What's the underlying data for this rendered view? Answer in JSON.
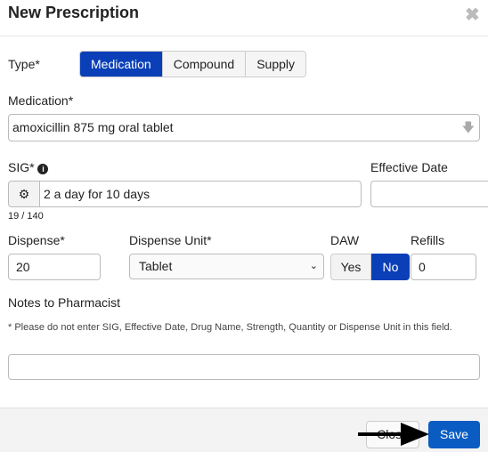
{
  "header": {
    "title": "New Prescription",
    "close_icon": "close-icon"
  },
  "type": {
    "label": "Type*",
    "options": [
      "Medication",
      "Compound",
      "Supply"
    ],
    "selected": "Medication"
  },
  "medication": {
    "label": "Medication*",
    "value": "amoxicillin 875 mg oral tablet"
  },
  "sig": {
    "label": "SIG*",
    "value": "2 a day for 10 days",
    "counter": "19 / 140"
  },
  "effective_date": {
    "label": "Effective Date",
    "value": ""
  },
  "dispense": {
    "label": "Dispense*",
    "value": "20"
  },
  "dispense_unit": {
    "label": "Dispense Unit*",
    "value": "Tablet"
  },
  "daw": {
    "label": "DAW",
    "yes": "Yes",
    "no": "No",
    "selected": "No"
  },
  "refills": {
    "label": "Refills",
    "value": "0"
  },
  "notes": {
    "label": "Notes to Pharmacist",
    "hint": "* Please do not enter SIG, Effective Date, Drug Name, Strength, Quantity or Dispense Unit in this field.",
    "value": ""
  },
  "footer": {
    "close": "Close",
    "save": "Save"
  },
  "colors": {
    "accent": "#0a3fb8",
    "save": "#0a5cc2"
  }
}
